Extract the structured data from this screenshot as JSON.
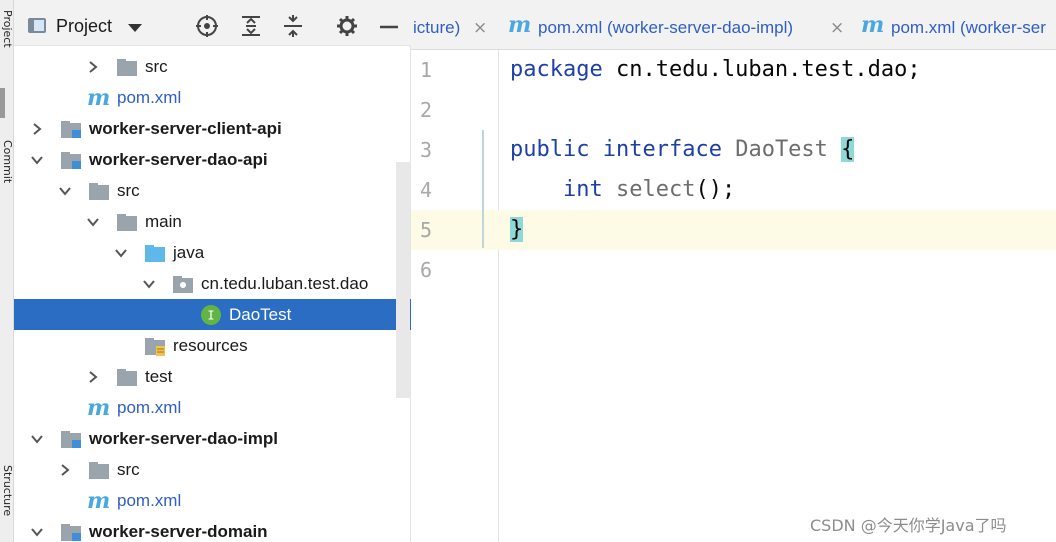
{
  "tool_strip": {
    "project_label": "Project",
    "commit_label": "Commit",
    "structure_label": "Structure"
  },
  "panel": {
    "title": "Project",
    "header_icons": [
      "locate-icon",
      "expand-all-icon",
      "collapse-all-icon",
      "gear-icon",
      "hide-icon"
    ]
  },
  "tree": [
    {
      "label": "src",
      "icon": "folder-icon",
      "expanded": false,
      "bold": false
    },
    {
      "label": "pom.xml",
      "icon": "maven-icon",
      "bold": false
    },
    {
      "label": "worker-server-client-api",
      "icon": "module-icon",
      "expanded": false,
      "bold": true
    },
    {
      "label": "worker-server-dao-api",
      "icon": "module-icon",
      "expanded": true,
      "bold": true
    },
    {
      "label": "src",
      "icon": "folder-icon",
      "expanded": true,
      "bold": false
    },
    {
      "label": "main",
      "icon": "folder-icon",
      "expanded": true,
      "bold": false
    },
    {
      "label": "java",
      "icon": "source-folder-icon",
      "expanded": true,
      "bold": false
    },
    {
      "label": "cn.tedu.luban.test.dao",
      "icon": "package-icon",
      "expanded": true,
      "bold": false
    },
    {
      "label": "DaoTest",
      "icon": "interface-icon",
      "bold": false,
      "selected": true
    },
    {
      "label": "resources",
      "icon": "resources-folder-icon",
      "bold": false
    },
    {
      "label": "test",
      "icon": "folder-icon",
      "expanded": false,
      "bold": false
    },
    {
      "label": "pom.xml",
      "icon": "maven-icon",
      "bold": false
    },
    {
      "label": "worker-server-dao-impl",
      "icon": "module-icon",
      "expanded": true,
      "bold": true
    },
    {
      "label": "src",
      "icon": "folder-icon",
      "expanded": false,
      "bold": false
    },
    {
      "label": "pom.xml",
      "icon": "maven-icon",
      "bold": false
    },
    {
      "label": "worker-server-domain",
      "icon": "module-icon",
      "expanded": true,
      "bold": true
    }
  ],
  "tabs": [
    {
      "text": "icture)",
      "close": "×"
    },
    {
      "icon": "m",
      "text": "pom.xml (worker-server-dao-impl)",
      "close": "×"
    },
    {
      "icon": "m",
      "text": "pom.xml (worker-ser"
    }
  ],
  "editor": {
    "line_numbers": [
      "1",
      "2",
      "3",
      "4",
      "5",
      "6"
    ],
    "current_line": 5,
    "code": {
      "l1_kw": "package",
      "l1_rest": " cn.tedu.luban.test.dao;",
      "l3_kw1": "public",
      "l3_kw2": "interface",
      "l3_name": "DaoTest",
      "l3_brace": "{",
      "l4_kw": "int",
      "l4_method": "select",
      "l4_rest": "();",
      "l5_brace": "}"
    }
  },
  "watermark": "CSDN @今天你学Java了吗",
  "colors": {
    "selection": "#2b6dc2",
    "keyword": "#1d3fa8",
    "brace_match": "#8fd8d8",
    "current_line": "#fdfbe6",
    "maven_icon": "#4aa8e0"
  }
}
